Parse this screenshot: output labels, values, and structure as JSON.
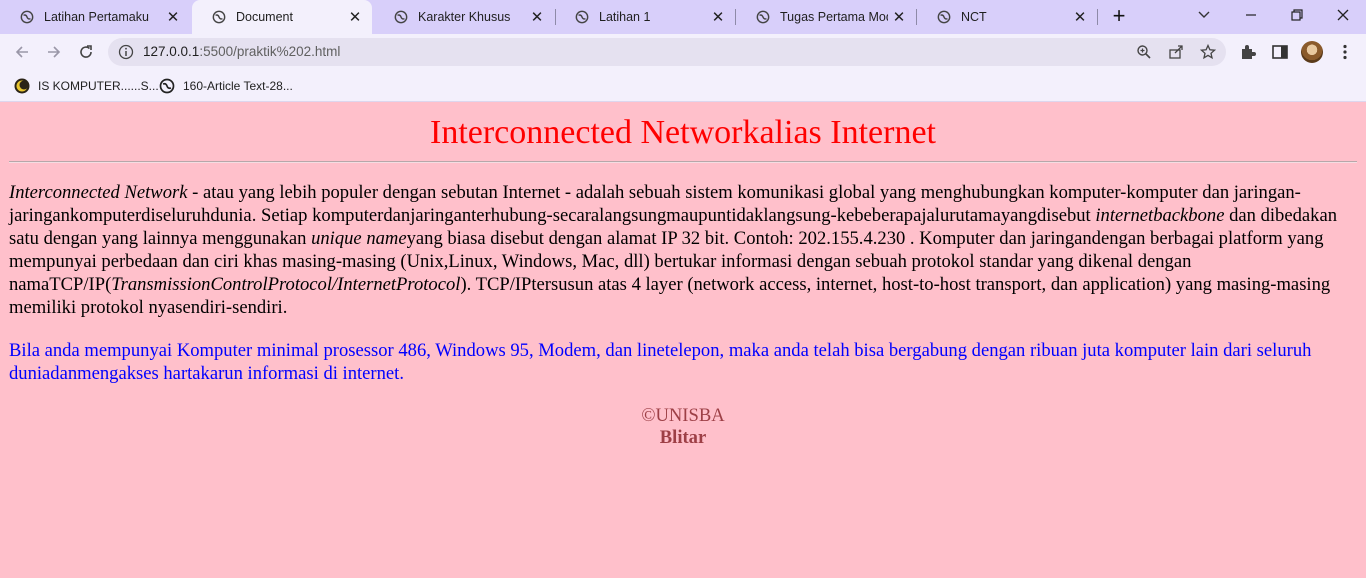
{
  "browser": {
    "tabs": [
      {
        "title": "Latihan Pertamaku",
        "active": false
      },
      {
        "title": "Document",
        "active": true
      },
      {
        "title": "Karakter Khusus",
        "active": false
      },
      {
        "title": "Latihan 1",
        "active": false
      },
      {
        "title": "Tugas Pertama Modul",
        "active": false
      },
      {
        "title": "NCT",
        "active": false
      }
    ],
    "close_glyph": "✕",
    "new_tab_glyph": "+",
    "url_host": "127.0.0.1",
    "url_path": ":5500/praktik%202.html",
    "bookmarks": [
      {
        "label": "IS KOMPUTER......S...",
        "icon": "moon-star-icon"
      },
      {
        "label": "160-Article Text-28...",
        "icon": "globe-icon"
      }
    ]
  },
  "page": {
    "heading": "Interconnected Networkalias Internet",
    "para1": {
      "em1": "Interconnected Network",
      "t1": " - atau yang lebih populer dengan sebutan Internet - adalah sebuah sistem komunikasi global yang menghubungkan komputer-komputer dan jaringan-jaringankomputerdiseluruhdunia. Setiap komputerdanjaringanterhubung-secaralangsungmaupuntidaklangsung-kebeberapajalurutamayangdisebut ",
      "em2": "internetbackbone",
      "t2": " dan dibedakan satu dengan yang lainnya menggunakan ",
      "em3": "unique name",
      "t3": "yang biasa disebut dengan alamat IP 32 bit. Contoh: 202.155.4.230 . Komputer dan jaringandengan berbagai platform yang mempunyai perbedaan dan ciri khas masing-masing (Unix,Linux, Windows, Mac, dll) bertukar informasi dengan sebuah protokol standar yang dikenal dengan namaTCP/IP(",
      "em4": "TransmissionControlProtocol/InternetProtocol",
      "t4": "). TCP/IPtersusun atas 4 layer (network access, internet, host-to-host transport, dan application) yang masing-masing memiliki protokol nyasendiri-sendiri."
    },
    "para2": "Bila anda mempunyai Komputer minimal prosessor 486, Windows 95, Modem, dan linetelepon, maka anda telah bisa bergabung dengan ribuan juta komputer lain dari seluruh duniadanmengakses hartakarun informasi di internet.",
    "footer_line1": "©UNISBA",
    "footer_line2": "Blitar"
  },
  "colors": {
    "page_bg": "#ffc0cb",
    "heading": "#ff0000",
    "para2": "#0000ff",
    "footer": "#9d3f46",
    "tabstrip": "#d8cffa"
  }
}
